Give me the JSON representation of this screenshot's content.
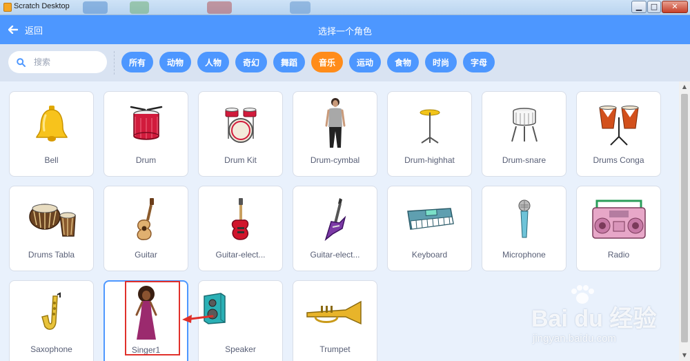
{
  "window": {
    "title": "Scratch Desktop",
    "controls": {
      "minimize": "▁",
      "maximize": "□",
      "close": "✕"
    }
  },
  "header": {
    "back_label": "返回",
    "title": "选择一个角色"
  },
  "search": {
    "placeholder": "搜索"
  },
  "tags": [
    {
      "label": "所有",
      "active": false
    },
    {
      "label": "动物",
      "active": false
    },
    {
      "label": "人物",
      "active": false
    },
    {
      "label": "奇幻",
      "active": false
    },
    {
      "label": "舞蹈",
      "active": false
    },
    {
      "label": "音乐",
      "active": true
    },
    {
      "label": "运动",
      "active": false
    },
    {
      "label": "食物",
      "active": false
    },
    {
      "label": "时尚",
      "active": false
    },
    {
      "label": "字母",
      "active": false
    }
  ],
  "sprites": [
    {
      "name": "Bell",
      "icon": "bell-icon"
    },
    {
      "name": "Drum",
      "icon": "drum-icon"
    },
    {
      "name": "Drum Kit",
      "icon": "drum-kit-icon"
    },
    {
      "name": "Drum-cymbal",
      "icon": "drum-cymbal-icon"
    },
    {
      "name": "Drum-highhat",
      "icon": "drum-highhat-icon"
    },
    {
      "name": "Drum-snare",
      "icon": "drum-snare-icon"
    },
    {
      "name": "Drums Conga",
      "icon": "drums-conga-icon"
    },
    {
      "name": "Drums Tabla",
      "icon": "drums-tabla-icon"
    },
    {
      "name": "Guitar",
      "icon": "guitar-icon"
    },
    {
      "name": "Guitar-elect...",
      "icon": "guitar-electric1-icon"
    },
    {
      "name": "Guitar-elect...",
      "icon": "guitar-electric2-icon"
    },
    {
      "name": "Keyboard",
      "icon": "keyboard-icon"
    },
    {
      "name": "Microphone",
      "icon": "microphone-icon"
    },
    {
      "name": "Radio",
      "icon": "radio-icon"
    },
    {
      "name": "Saxophone",
      "icon": "saxophone-icon"
    },
    {
      "name": "Singer1",
      "icon": "singer1-icon",
      "selected": true
    },
    {
      "name": "Speaker",
      "icon": "speaker-icon"
    },
    {
      "name": "Trumpet",
      "icon": "trumpet-icon"
    }
  ],
  "watermark": {
    "brand": "Bai du 经验",
    "url": "jingyan.baidu.com"
  },
  "colors": {
    "header": "#4d97ff",
    "active_tag": "#ff8c1a",
    "annotation": "#e0302a"
  }
}
